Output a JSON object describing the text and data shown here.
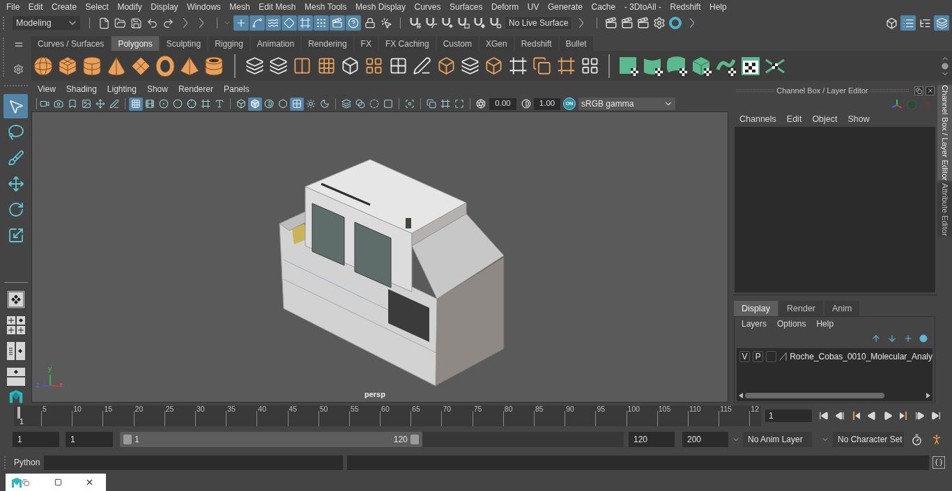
{
  "menu_bar": [
    "File",
    "Edit",
    "Create",
    "Select",
    "Modify",
    "Display",
    "Windows",
    "Mesh",
    "Edit Mesh",
    "Mesh Tools",
    "Mesh Display",
    "Curves",
    "Surfaces",
    "Deform",
    "UV",
    "Generate",
    "Cache",
    "- 3DtoAll -",
    "Redshift",
    "Help"
  ],
  "status_line": {
    "workspace": "Modeling",
    "selection_masks": [
      {
        "kind": "handle",
        "selected": true
      },
      {
        "kind": "joint",
        "selected": true
      },
      {
        "kind": "curve",
        "selected": true
      },
      {
        "kind": "surface",
        "selected": true
      },
      {
        "kind": "deformer",
        "selected": true
      },
      {
        "kind": "dynamic",
        "selected": true
      },
      {
        "kind": "render",
        "selected": true
      },
      {
        "kind": "misc",
        "selected": true
      }
    ],
    "snaps": [
      {
        "kind": "grid-snap",
        "selected": false
      },
      {
        "kind": "curve-snap",
        "selected": false
      },
      {
        "kind": "point-snap",
        "selected": false
      },
      {
        "kind": "view-snap",
        "selected": false
      },
      {
        "kind": "surface-snap",
        "selected": false
      },
      {
        "kind": "live-snap",
        "selected": false
      }
    ],
    "live_surface": "No Live Surface",
    "panel_toggles": [
      {
        "kind": "modeling-toolkit",
        "selected": false
      },
      {
        "kind": "attribute-editor",
        "selected": true
      },
      {
        "kind": "tool-settings",
        "selected": false
      },
      {
        "kind": "channel-box",
        "selected": true
      }
    ]
  },
  "shelf": {
    "tabs": [
      {
        "label": "Curves / Surfaces",
        "selected": false
      },
      {
        "label": "Polygons",
        "selected": true
      },
      {
        "label": "Sculpting",
        "selected": false
      },
      {
        "label": "Rigging",
        "selected": false
      },
      {
        "label": "Animation",
        "selected": false
      },
      {
        "label": "Rendering",
        "selected": false
      },
      {
        "label": "FX",
        "selected": false
      },
      {
        "label": "FX Caching",
        "selected": false
      },
      {
        "label": "Custom",
        "selected": false
      },
      {
        "label": "XGen",
        "selected": false
      },
      {
        "label": "Redshift",
        "selected": false
      },
      {
        "label": "Bullet",
        "selected": false
      }
    ]
  },
  "toolbox": {
    "tools": [
      {
        "kind": "select",
        "selected": true
      },
      {
        "kind": "lasso",
        "selected": false
      },
      {
        "kind": "paint",
        "selected": false
      },
      {
        "kind": "move",
        "selected": false
      },
      {
        "kind": "rotate",
        "selected": false
      },
      {
        "kind": "scale",
        "selected": false
      }
    ]
  },
  "viewport": {
    "menus": [
      "View",
      "Shading",
      "Lighting",
      "Show",
      "Renderer",
      "Panels"
    ],
    "toolbar_groups": [
      [
        {
          "kind": "camera",
          "selected": false
        },
        {
          "kind": "camera-attributes",
          "selected": false
        },
        {
          "kind": "bookmark",
          "selected": false
        },
        {
          "kind": "image-plane",
          "selected": false
        },
        {
          "kind": "pan-zoom",
          "selected": false
        },
        {
          "kind": "grease-pencil",
          "selected": false
        }
      ],
      [
        {
          "kind": "grid",
          "selected": true
        },
        {
          "kind": "film-gate",
          "selected": false
        },
        {
          "kind": "resolution-gate",
          "selected": false
        },
        {
          "kind": "gate-mask",
          "selected": false
        },
        {
          "kind": "field-chart",
          "selected": false
        },
        {
          "kind": "safe-action",
          "selected": false
        },
        {
          "kind": "safe-title",
          "selected": false
        }
      ],
      [
        {
          "kind": "wireframe",
          "selected": false
        },
        {
          "kind": "smooth-shade",
          "selected": true
        },
        {
          "kind": "default-material",
          "selected": false
        },
        {
          "kind": "wireframe-on-shaded",
          "selected": false
        },
        {
          "kind": "textured",
          "selected": true
        },
        {
          "kind": "lights",
          "selected": false
        },
        {
          "kind": "shadows",
          "selected": false
        }
      ],
      [
        {
          "kind": "ambient-occlusion",
          "selected": false
        },
        {
          "kind": "motion-blur",
          "selected": false
        },
        {
          "kind": "anti-aliasing",
          "selected": false
        },
        {
          "kind": "depth-of-field",
          "selected": false
        }
      ],
      [
        {
          "kind": "isolate",
          "selected": false
        }
      ],
      [
        {
          "kind": "xray",
          "selected": false
        },
        {
          "kind": "xray-active",
          "selected": false
        },
        {
          "kind": "xray-joints",
          "selected": false
        }
      ]
    ],
    "exposure": "0.00",
    "gamma": "1.00",
    "color_management": "ON",
    "color_space": "sRGB gamma",
    "axis_labels": [
      "y",
      "z",
      "x"
    ],
    "camera": "persp"
  },
  "channel_box": {
    "title": "Channel Box / Layer Editor",
    "menus": [
      "Channels",
      "Edit",
      "Object",
      "Show"
    ]
  },
  "layer_editor": {
    "tabs": [
      {
        "label": "Display",
        "selected": true
      },
      {
        "label": "Render",
        "selected": false
      },
      {
        "label": "Anim",
        "selected": false
      }
    ],
    "menus": [
      "Layers",
      "Options",
      "Help"
    ],
    "layers": [
      {
        "visibility": "V",
        "playback": "P",
        "name": "Roche_Cobas_0010_Molecular_Analy"
      }
    ]
  },
  "side_tabs": [
    {
      "label": "Channel Box / Layer Editor",
      "selected": true
    },
    {
      "label": "Attribute Editor",
      "selected": false
    }
  ],
  "time_slider": {
    "tick_labels": [
      "5",
      "10",
      "15",
      "20",
      "25",
      "30",
      "35",
      "40",
      "45",
      "50",
      "55",
      "60",
      "65",
      "70",
      "75",
      "80",
      "85",
      "90",
      "95",
      "100",
      "105",
      "110",
      "115",
      "12"
    ],
    "frame_label": "1",
    "level": 0,
    "current_frame": "1"
  },
  "range_slider": {
    "animation_start": "1",
    "playback_start": "1",
    "range_start": "1",
    "range_end": "120",
    "level": 0.6,
    "playback_end": "120",
    "animation_end": "200",
    "anim_layer": "No Anim Layer",
    "character_set": "No Character Set"
  },
  "command_line": {
    "language": "Python"
  }
}
